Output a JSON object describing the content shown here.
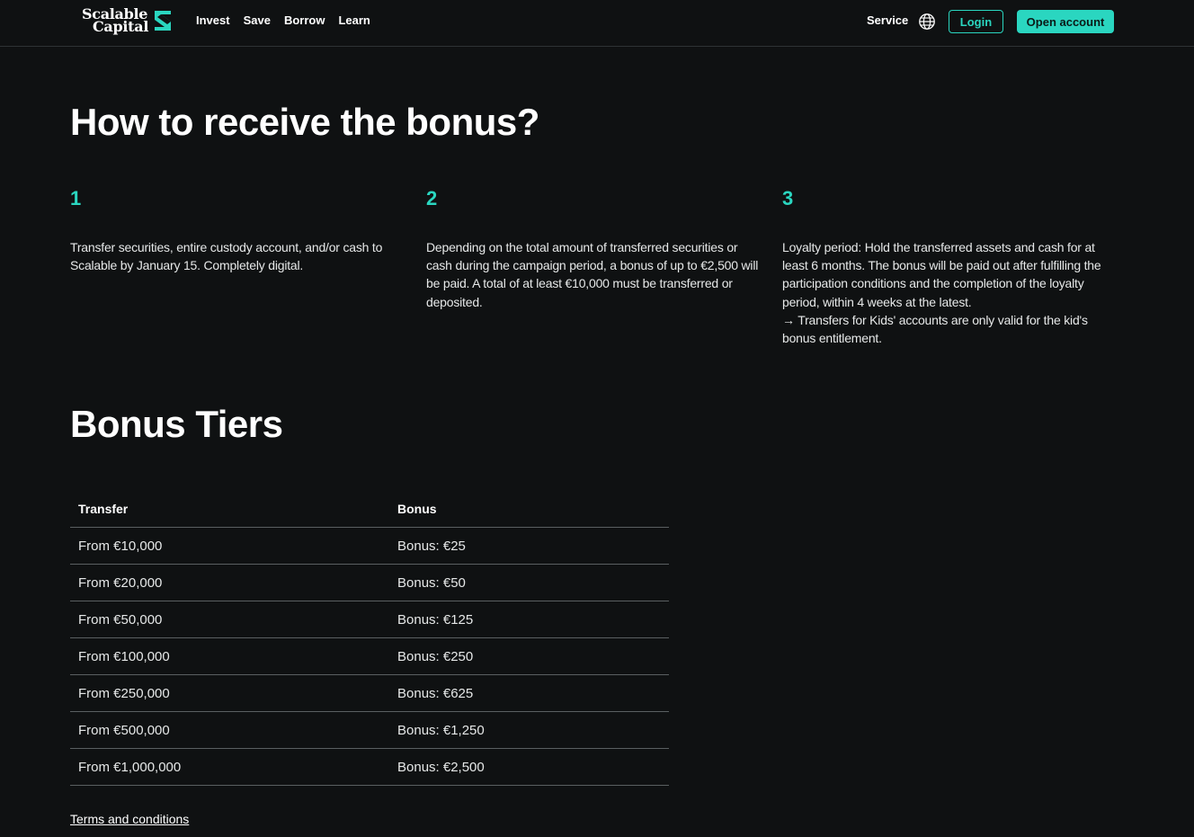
{
  "header": {
    "logo": {
      "line1": "Scalable",
      "line2": "Capital"
    },
    "nav": [
      "Invest",
      "Save",
      "Borrow",
      "Learn"
    ],
    "service_label": "Service",
    "login_label": "Login",
    "open_account_label": "Open account",
    "accent_color": "#2ad6c0"
  },
  "how_section": {
    "title": "How to receive the bonus?",
    "steps": [
      {
        "number": "1",
        "text": "Transfer securities, entire custody account, and/or cash to Scalable by January 15. Completely digital."
      },
      {
        "number": "2",
        "text": "Depending on the total amount of transferred securities or cash during the campaign period, a bonus of up to €2,500 will be paid. A total of at least €10,000 must be transferred or deposited."
      },
      {
        "number": "3",
        "text": "Loyalty period: Hold the transferred assets and cash for at least 6 months. The bonus will be paid out after fulfilling the participation conditions and the completion of the loyalty period, within 4 weeks at the latest.",
        "note": "→ Transfers for Kids' accounts are only valid for the kid's bonus entitlement."
      }
    ]
  },
  "tiers_section": {
    "title": "Bonus Tiers",
    "columns": [
      "Transfer",
      "Bonus"
    ],
    "rows": [
      [
        "From €10,000",
        "Bonus: €25"
      ],
      [
        "From €20,000",
        "Bonus: €50"
      ],
      [
        "From €50,000",
        "Bonus: €125"
      ],
      [
        "From €100,000",
        "Bonus: €250"
      ],
      [
        "From €250,000",
        "Bonus: €625"
      ],
      [
        "From €500,000",
        "Bonus: €1,250"
      ],
      [
        "From €1,000,000",
        "Bonus: €2,500"
      ]
    ],
    "terms_link": "Terms and conditions"
  }
}
